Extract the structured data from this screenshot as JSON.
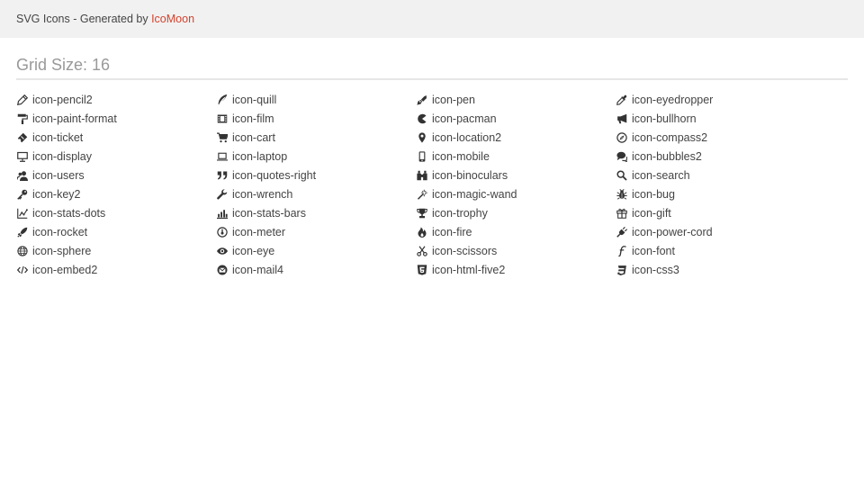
{
  "header": {
    "prefix": "SVG Icons - Generated by ",
    "brand": "IcoMoon",
    "brand_color": "#d1432f"
  },
  "grid": {
    "title": "Grid Size: 16",
    "columns": [
      {
        "items": [
          {
            "label": "icon-pencil2",
            "icon": "pencil-icon"
          },
          {
            "label": "icon-paint-format",
            "icon": "paint-roller-icon"
          },
          {
            "label": "icon-ticket",
            "icon": "ticket-icon"
          },
          {
            "label": "icon-display",
            "icon": "monitor-icon"
          },
          {
            "label": "icon-users",
            "icon": "users-icon"
          },
          {
            "label": "icon-key2",
            "icon": "key-icon"
          },
          {
            "label": "icon-stats-dots",
            "icon": "stats-dots-icon"
          },
          {
            "label": "icon-rocket",
            "icon": "rocket-icon"
          },
          {
            "label": "icon-sphere",
            "icon": "globe-icon"
          },
          {
            "label": "icon-embed2",
            "icon": "code-icon"
          }
        ]
      },
      {
        "items": [
          {
            "label": "icon-quill",
            "icon": "quill-icon"
          },
          {
            "label": "icon-film",
            "icon": "film-icon"
          },
          {
            "label": "icon-cart",
            "icon": "cart-icon"
          },
          {
            "label": "icon-laptop",
            "icon": "laptop-icon"
          },
          {
            "label": "icon-quotes-right",
            "icon": "quotes-icon"
          },
          {
            "label": "icon-wrench",
            "icon": "wrench-icon"
          },
          {
            "label": "icon-stats-bars",
            "icon": "bar-chart-icon"
          },
          {
            "label": "icon-meter",
            "icon": "meter-icon"
          },
          {
            "label": "icon-eye",
            "icon": "eye-icon"
          },
          {
            "label": "icon-mail4",
            "icon": "mail-icon"
          }
        ]
      },
      {
        "items": [
          {
            "label": "icon-pen",
            "icon": "pen-icon"
          },
          {
            "label": "icon-pacman",
            "icon": "pacman-icon"
          },
          {
            "label": "icon-location2",
            "icon": "location-pin-icon"
          },
          {
            "label": "icon-mobile",
            "icon": "mobile-icon"
          },
          {
            "label": "icon-binoculars",
            "icon": "binoculars-icon"
          },
          {
            "label": "icon-magic-wand",
            "icon": "magic-wand-icon"
          },
          {
            "label": "icon-trophy",
            "icon": "trophy-icon"
          },
          {
            "label": "icon-fire",
            "icon": "fire-icon"
          },
          {
            "label": "icon-scissors",
            "icon": "scissors-icon"
          },
          {
            "label": "icon-html-five2",
            "icon": "html5-icon"
          }
        ]
      },
      {
        "items": [
          {
            "label": "icon-eyedropper",
            "icon": "eyedropper-icon"
          },
          {
            "label": "icon-bullhorn",
            "icon": "bullhorn-icon"
          },
          {
            "label": "icon-compass2",
            "icon": "compass-icon"
          },
          {
            "label": "icon-bubbles2",
            "icon": "chat-bubbles-icon"
          },
          {
            "label": "icon-search",
            "icon": "search-icon"
          },
          {
            "label": "icon-bug",
            "icon": "bug-icon"
          },
          {
            "label": "icon-gift",
            "icon": "gift-icon"
          },
          {
            "label": "icon-power-cord",
            "icon": "power-plug-icon"
          },
          {
            "label": "icon-font",
            "icon": "font-icon"
          },
          {
            "label": "icon-css3",
            "icon": "css3-icon"
          }
        ]
      }
    ]
  }
}
